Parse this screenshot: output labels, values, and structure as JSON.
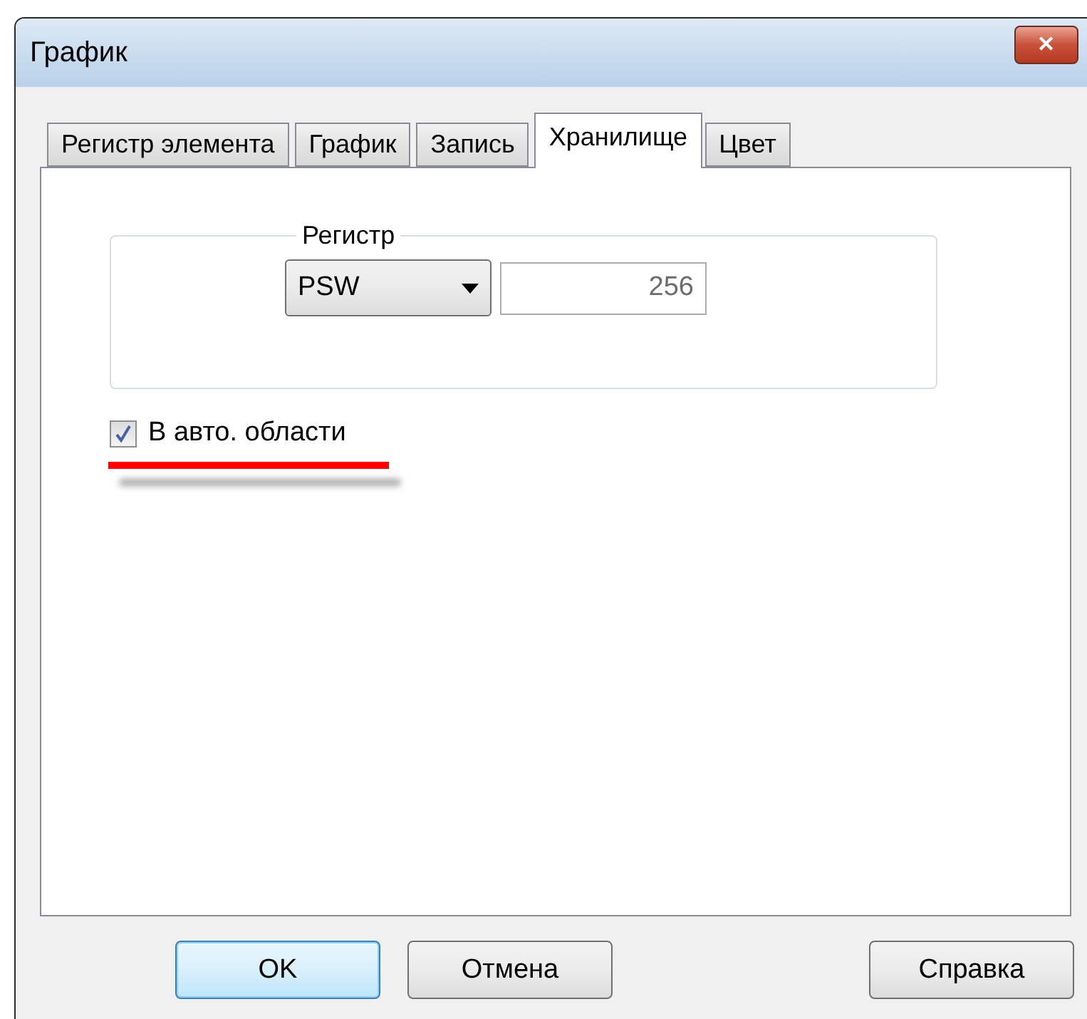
{
  "window": {
    "title": "График",
    "close": "✕"
  },
  "tabs": [
    {
      "label": "Регистр элемента",
      "selected": false
    },
    {
      "label": "График",
      "selected": false
    },
    {
      "label": "Запись",
      "selected": false
    },
    {
      "label": "Хранилище",
      "selected": true
    },
    {
      "label": "Цвет",
      "selected": false
    }
  ],
  "register_group": {
    "legend": "Регистр",
    "device": "PSW",
    "address": "256"
  },
  "auto_area": {
    "label": "В авто. области",
    "checked": true,
    "underlined": true
  },
  "buttons": [
    {
      "label": "OK",
      "kind": "default"
    },
    {
      "label": "Отмена",
      "kind": "normal"
    },
    {
      "label": "Справка",
      "kind": "help"
    }
  ]
}
